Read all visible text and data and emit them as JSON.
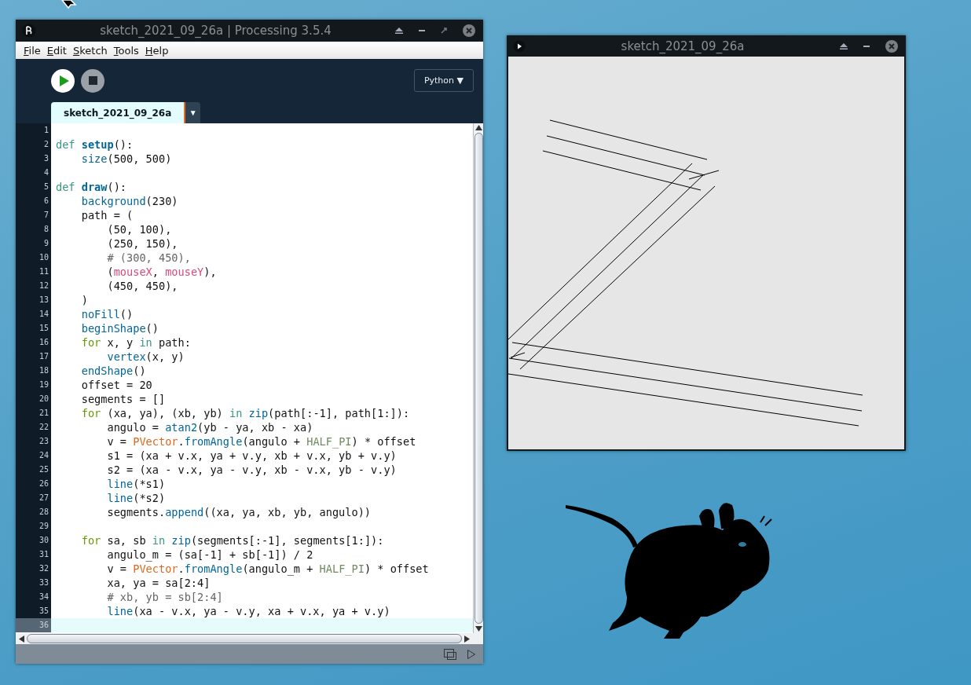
{
  "ide_window": {
    "title": "sketch_2021_09_26a | Processing 3.5.4",
    "menu": [
      "File",
      "Edit",
      "Sketch",
      "Tools",
      "Help"
    ],
    "mode": "Python ▼",
    "tabs": [
      {
        "label": "sketch_2021_09_26a",
        "selected": true
      }
    ],
    "tab_menu": "▼",
    "lines": [
      {
        "n": "1",
        "current": false
      },
      {
        "n": "2",
        "current": false,
        "tokens": [
          {
            "kind": "keyword",
            "t": "def "
          },
          {
            "kind": "defname",
            "t": "setup"
          },
          {
            "kind": "plain",
            "t": "():"
          }
        ]
      },
      {
        "n": "3",
        "current": false,
        "tokens": [
          {
            "kind": "function",
            "t": "    size"
          },
          {
            "kind": "plain",
            "t": "(500, 500)"
          }
        ]
      },
      {
        "n": "4",
        "current": false
      },
      {
        "n": "5",
        "current": false,
        "tokens": [
          {
            "kind": "keyword",
            "t": "def "
          },
          {
            "kind": "defname",
            "t": "draw"
          },
          {
            "kind": "plain",
            "t": "():"
          }
        ]
      },
      {
        "n": "6",
        "current": false,
        "tokens": [
          {
            "kind": "function",
            "t": "    background"
          },
          {
            "kind": "plain",
            "t": "(230)"
          }
        ]
      },
      {
        "n": "7",
        "current": false,
        "tokens": [
          {
            "kind": "plain",
            "t": "    path = ("
          }
        ]
      },
      {
        "n": "8",
        "current": false,
        "tokens": [
          {
            "kind": "plain",
            "t": "        (50, 100),"
          }
        ]
      },
      {
        "n": "9",
        "current": false,
        "tokens": [
          {
            "kind": "plain",
            "t": "        (250, 150),"
          }
        ]
      },
      {
        "n": "10",
        "current": false,
        "tokens": [
          {
            "kind": "comment",
            "t": "        # (300, 450),"
          }
        ]
      },
      {
        "n": "11",
        "current": false,
        "tokens": [
          {
            "kind": "plain",
            "t": "        ("
          },
          {
            "kind": "variable",
            "t": "mouseX"
          },
          {
            "kind": "plain",
            "t": ", "
          },
          {
            "kind": "variable",
            "t": "mouseY"
          },
          {
            "kind": "plain",
            "t": "),"
          }
        ]
      },
      {
        "n": "12",
        "current": false,
        "tokens": [
          {
            "kind": "plain",
            "t": "        (450, 450),"
          }
        ]
      },
      {
        "n": "13",
        "current": false,
        "tokens": [
          {
            "kind": "plain",
            "t": "    )"
          }
        ]
      },
      {
        "n": "14",
        "current": false,
        "tokens": [
          {
            "kind": "function",
            "t": "    noFill"
          },
          {
            "kind": "plain",
            "t": "()"
          }
        ]
      },
      {
        "n": "15",
        "current": false,
        "tokens": [
          {
            "kind": "function",
            "t": "    beginShape"
          },
          {
            "kind": "plain",
            "t": "()"
          }
        ]
      },
      {
        "n": "16",
        "current": false,
        "tokens": [
          {
            "kind": "loop",
            "t": "    for"
          },
          {
            "kind": "plain",
            "t": " x, y "
          },
          {
            "kind": "keyword",
            "t": "in"
          },
          {
            "kind": "plain",
            "t": " path:"
          }
        ]
      },
      {
        "n": "17",
        "current": false,
        "tokens": [
          {
            "kind": "function",
            "t": "        vertex"
          },
          {
            "kind": "plain",
            "t": "(x, y)"
          }
        ]
      },
      {
        "n": "18",
        "current": false,
        "tokens": [
          {
            "kind": "function",
            "t": "    endShape"
          },
          {
            "kind": "plain",
            "t": "()"
          }
        ]
      },
      {
        "n": "19",
        "current": false,
        "tokens": [
          {
            "kind": "plain",
            "t": "    offset = 20"
          }
        ]
      },
      {
        "n": "20",
        "current": false,
        "tokens": [
          {
            "kind": "plain",
            "t": "    segments = []"
          }
        ]
      },
      {
        "n": "21",
        "current": false,
        "tokens": [
          {
            "kind": "loop",
            "t": "    for"
          },
          {
            "kind": "plain",
            "t": " (xa, ya), (xb, yb) "
          },
          {
            "kind": "keyword",
            "t": "in"
          },
          {
            "kind": "function",
            "t": " zip"
          },
          {
            "kind": "plain",
            "t": "(path[:-1], path[1:]):"
          }
        ]
      },
      {
        "n": "22",
        "current": false,
        "tokens": [
          {
            "kind": "plain",
            "t": "        angulo = "
          },
          {
            "kind": "function",
            "t": "atan2"
          },
          {
            "kind": "plain",
            "t": "(yb - ya, xb - xa)"
          }
        ]
      },
      {
        "n": "23",
        "current": false,
        "tokens": [
          {
            "kind": "plain",
            "t": "        v = "
          },
          {
            "kind": "class",
            "t": "PVector"
          },
          {
            "kind": "plain",
            "t": "."
          },
          {
            "kind": "function",
            "t": "fromAngle"
          },
          {
            "kind": "plain",
            "t": "(angulo + "
          },
          {
            "kind": "constant",
            "t": "HALF_PI"
          },
          {
            "kind": "plain",
            "t": ") * offset"
          }
        ]
      },
      {
        "n": "24",
        "current": false,
        "tokens": [
          {
            "kind": "plain",
            "t": "        s1 = (xa + v.x, ya + v.y, xb + v.x, yb + v.y)"
          }
        ]
      },
      {
        "n": "25",
        "current": false,
        "tokens": [
          {
            "kind": "plain",
            "t": "        s2 = (xa - v.x, ya - v.y, xb - v.x, yb - v.y)"
          }
        ]
      },
      {
        "n": "26",
        "current": false,
        "tokens": [
          {
            "kind": "function",
            "t": "        line"
          },
          {
            "kind": "plain",
            "t": "(*s1)"
          }
        ]
      },
      {
        "n": "27",
        "current": false,
        "tokens": [
          {
            "kind": "function",
            "t": "        line"
          },
          {
            "kind": "plain",
            "t": "(*s2)"
          }
        ]
      },
      {
        "n": "28",
        "current": false,
        "tokens": [
          {
            "kind": "plain",
            "t": "        segments."
          },
          {
            "kind": "function",
            "t": "append"
          },
          {
            "kind": "plain",
            "t": "((xa, ya, xb, yb, angulo))"
          }
        ]
      },
      {
        "n": "29",
        "current": false
      },
      {
        "n": "30",
        "current": false,
        "tokens": [
          {
            "kind": "loop",
            "t": "    for"
          },
          {
            "kind": "plain",
            "t": " sa, sb "
          },
          {
            "kind": "keyword",
            "t": "in"
          },
          {
            "kind": "function",
            "t": " zip"
          },
          {
            "kind": "plain",
            "t": "(segments[:-1], segments[1:]):"
          }
        ]
      },
      {
        "n": "31",
        "current": false,
        "tokens": [
          {
            "kind": "plain",
            "t": "        angulo_m = (sa[-1] + sb[-1]) / 2"
          }
        ]
      },
      {
        "n": "32",
        "current": false,
        "tokens": [
          {
            "kind": "plain",
            "t": "        v = "
          },
          {
            "kind": "class",
            "t": "PVector"
          },
          {
            "kind": "plain",
            "t": "."
          },
          {
            "kind": "function",
            "t": "fromAngle"
          },
          {
            "kind": "plain",
            "t": "(angulo_m + "
          },
          {
            "kind": "constant",
            "t": "HALF_PI"
          },
          {
            "kind": "plain",
            "t": ") * offset"
          }
        ]
      },
      {
        "n": "33",
        "current": false,
        "tokens": [
          {
            "kind": "plain",
            "t": "        xa, ya = sa[2:4]"
          }
        ]
      },
      {
        "n": "34",
        "current": false,
        "tokens": [
          {
            "kind": "comment",
            "t": "        # xb, yb = sb[2:4]"
          }
        ]
      },
      {
        "n": "35",
        "current": false,
        "tokens": [
          {
            "kind": "function",
            "t": "        line"
          },
          {
            "kind": "plain",
            "t": "(xa - v.x, ya - v.y, xa + v.x, ya + v.y)"
          }
        ]
      },
      {
        "n": "36",
        "current": true
      }
    ]
  },
  "sketch_window": {
    "title": "sketch_2021_09_26a"
  }
}
